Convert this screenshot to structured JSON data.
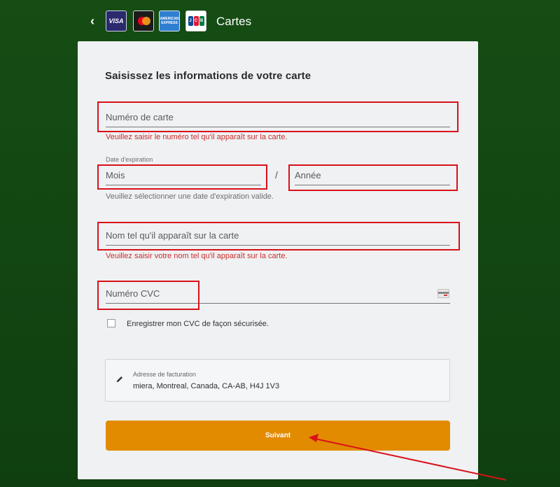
{
  "header": {
    "back_icon": "chevron-left-icon",
    "card_brands": [
      "VISA",
      "Mastercard",
      "American Express",
      "JCB"
    ],
    "visa_text": "VISA",
    "amex_text_top": "AMERICAN",
    "amex_text_bottom": "EXPRESS",
    "title": "Cartes"
  },
  "form": {
    "title": "Saisissez les informations de votre carte",
    "card_number": {
      "placeholder": "Numéro de carte",
      "error": "Veuillez saisir le numéro tel qu'il apparaît sur la carte."
    },
    "expiry": {
      "label": "Date d'expiration",
      "month_placeholder": "Mois",
      "separator": "/",
      "year_placeholder": "Année",
      "error": "Veuillez sélectionner une date d'expiration valide."
    },
    "name": {
      "placeholder": "Nom tel qu'il apparaît sur la carte",
      "error": "Veuillez saisir votre nom tel qu'il apparaît sur la carte."
    },
    "cvc": {
      "placeholder": "Numéro CVC",
      "icon": "credit-card-cvc-icon"
    },
    "save_cvc": {
      "label": "Enregistrer mon CVC de façon sécurisée.",
      "checked": false
    },
    "billing": {
      "title": "Adresse de facturation",
      "value": "miera, Montreal, Canada, CA-AB, H4J 1V3",
      "icon": "pencil-icon"
    },
    "next_label": "Suivant"
  },
  "colors": {
    "background": "#154d14",
    "accent": "#e38b00",
    "error": "#cc2b2b",
    "annotation": "#d9111a"
  }
}
